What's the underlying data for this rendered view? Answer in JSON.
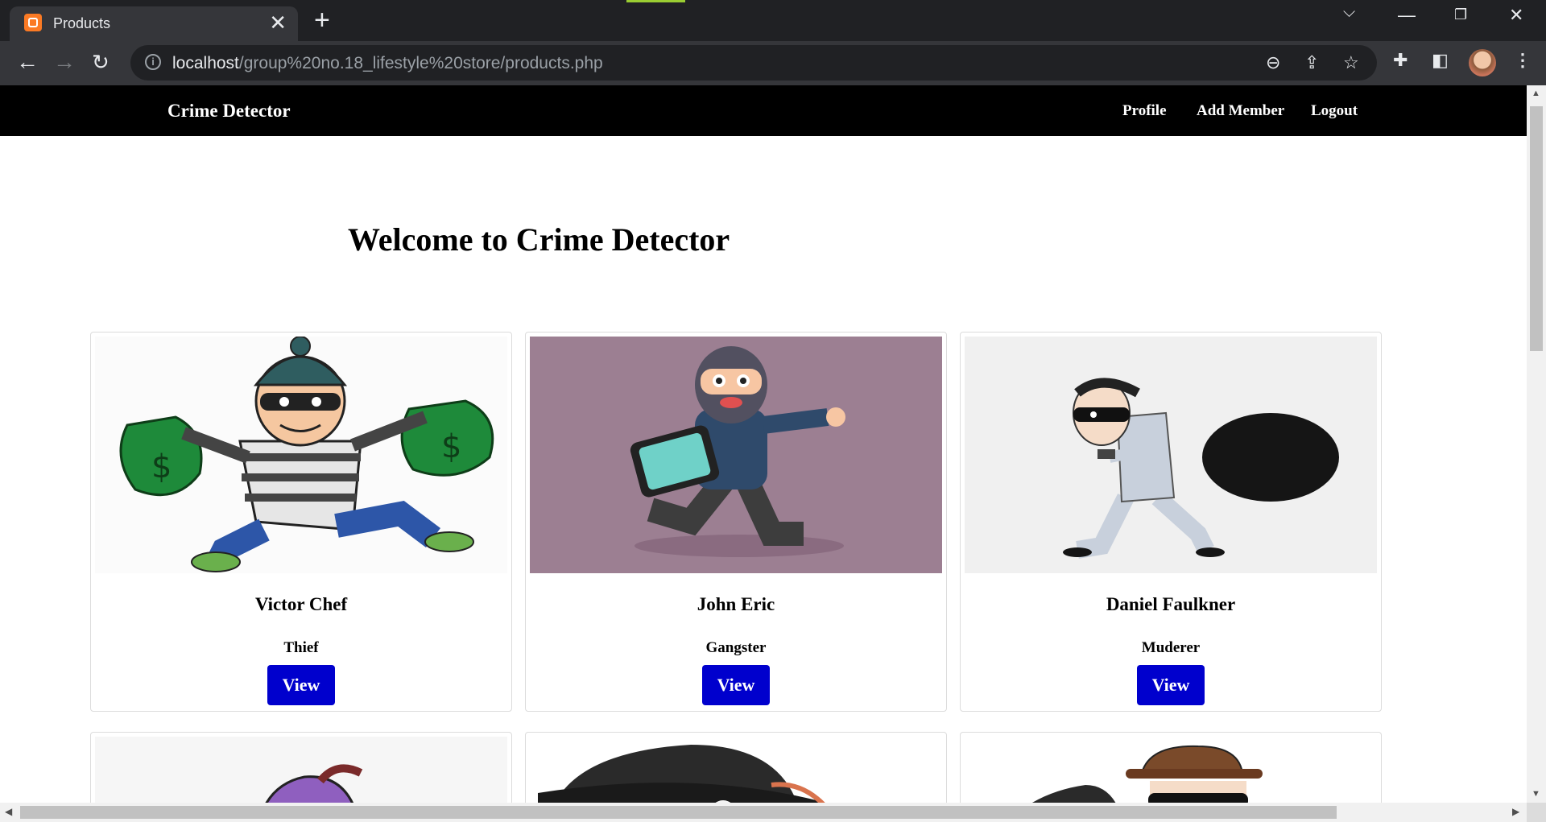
{
  "browser": {
    "tab_title": "Products",
    "tab_close": "✕",
    "new_tab": "+",
    "url_host": "localhost",
    "url_path": "/group%20no.18_lifestyle%20store/products.php",
    "info_glyph": "i",
    "icons": [
      "zoom-out-icon",
      "share-icon",
      "bookmark-star-icon",
      "extensions-icon",
      "side-panel-icon",
      "profile-avatar",
      "menu-icon"
    ]
  },
  "site": {
    "brand": "Crime Detector",
    "nav": {
      "profile": "Profile",
      "add_member": "Add Member",
      "logout": "Logout"
    },
    "heading": "Welcome to Crime Detector"
  },
  "cards": [
    {
      "name": "Victor Chef",
      "role": "Thief",
      "button": "View"
    },
    {
      "name": "John Eric",
      "role": "Gangster",
      "button": "View"
    },
    {
      "name": "Daniel Faulkner",
      "role": "Muderer",
      "button": "View"
    }
  ],
  "colors": {
    "navbar": "#000000",
    "button": "#0000cd",
    "card2_bg": "#9c7f92",
    "card3_bg": "#f0f0f0"
  }
}
